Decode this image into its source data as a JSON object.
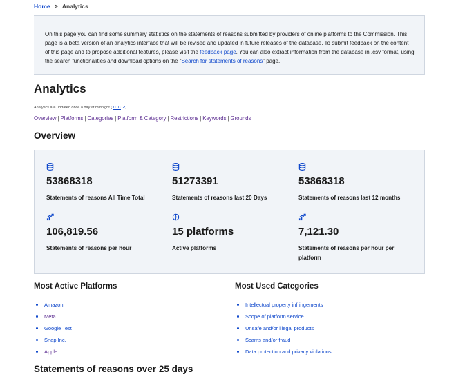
{
  "breadcrumb": {
    "home": "Home",
    "separator": ">",
    "current": "Analytics"
  },
  "notice": {
    "text_before": "On this page you can find some summary statistics on the statements of reasons submitted by providers of online platforms to the Commission. This page is a beta version of an analytics interface that will be revised and updated in future releases of the database. To submit feedback on the content of this page and to propose additional features, please visit the ",
    "feedback_link": "feedback page",
    "text_middle": ". You can also extract information from the database in .csv format, using the search functionalities and download options on the “",
    "search_link": "Search for statements of reasons",
    "text_after": "” page."
  },
  "page_title": "Analytics",
  "updated": {
    "prefix": "Analytics are updated once a day at midnight (",
    "utc": "UTC",
    "suffix": ")."
  },
  "nav": [
    "Overview",
    "Platforms",
    "Categories",
    "Platform & Category",
    "Restrictions",
    "Keywords",
    "Grounds"
  ],
  "overview_heading": "Overview",
  "stats": [
    {
      "icon": "database-icon",
      "value": "53868318",
      "label": "Statements of reasons All Time Total"
    },
    {
      "icon": "database-icon",
      "value": "51273391",
      "label": "Statements of reasons last 20 Days"
    },
    {
      "icon": "database-icon",
      "value": "53868318",
      "label": "Statements of reasons last 12 months"
    },
    {
      "icon": "trending-up-icon",
      "value": "106,819.56",
      "label": "Statements of reasons per hour"
    },
    {
      "icon": "network-icon",
      "value": "15 platforms",
      "label": "Active platforms"
    },
    {
      "icon": "trending-up-icon",
      "value": "7,121.30",
      "label": "Statements of reasons per hour per platform"
    }
  ],
  "most_active": {
    "heading": "Most Active Platforms",
    "items": [
      "Amazon",
      "Meta",
      "Google Test",
      "Snap Inc.",
      "Apple"
    ]
  },
  "most_used": {
    "heading": "Most Used Categories",
    "items": [
      "Intellectual property infringements",
      "Scope of platform service",
      "Unsafe and/or illegal products",
      "Scams and/or fraud",
      "Data protection and privacy violations"
    ]
  },
  "over_days_heading": "Statements of reasons over 25 days",
  "colors": {
    "link": "#0e47cb",
    "visited": "#5c2d91",
    "panel_bg": "#f1f4f8",
    "panel_border": "#cfd6e0"
  }
}
